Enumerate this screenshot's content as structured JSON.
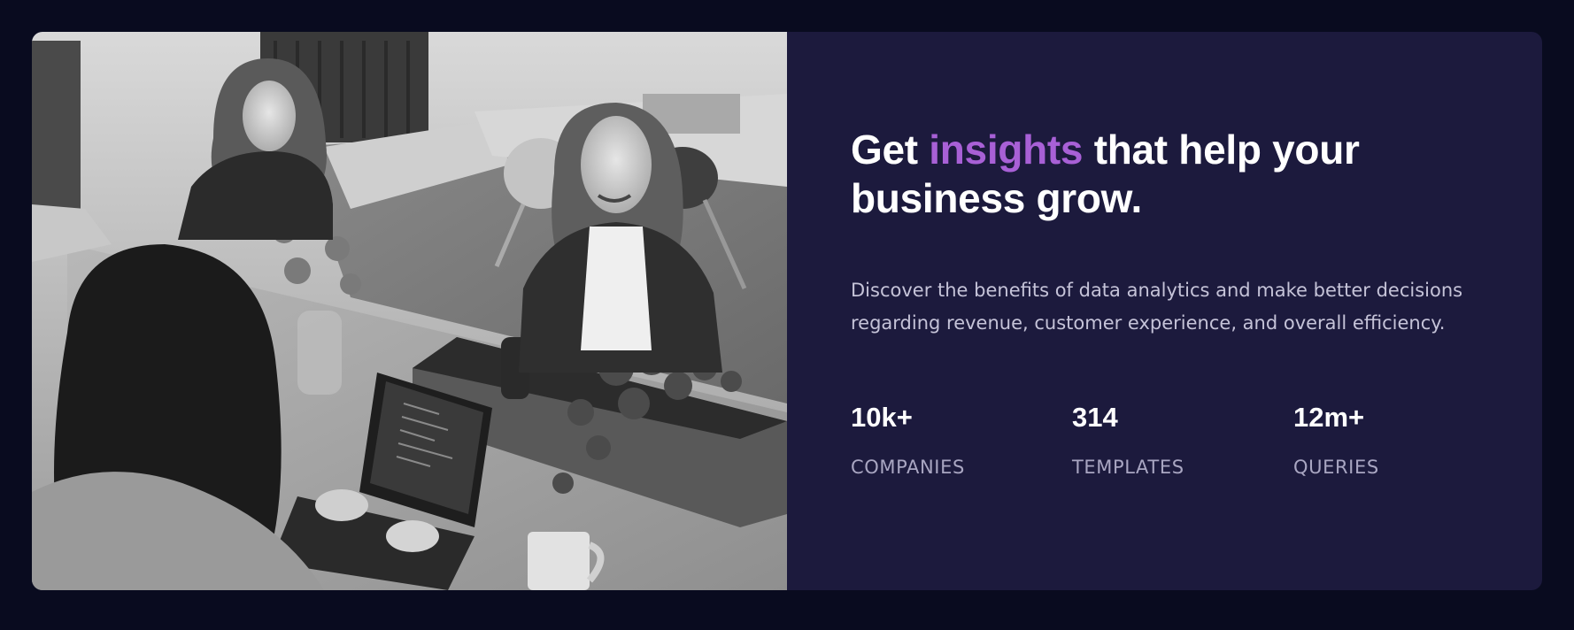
{
  "heading": {
    "prefix": "Get ",
    "highlight": "insights",
    "suffix": " that help your business grow."
  },
  "description": "Discover the benefits of data analytics and make better decisions regarding revenue, customer experience, and overall efficiency.",
  "stats": [
    {
      "value": "10k+",
      "label": "COMPANIES"
    },
    {
      "value": "314",
      "label": "TEMPLATES"
    },
    {
      "value": "12m+",
      "label": "QUERIES"
    }
  ],
  "colors": {
    "page_background": "#090b1f",
    "card_background": "#1c1a3d",
    "accent": "#a860d6",
    "heading": "#ffffff",
    "body_text": "#c5c3d8",
    "stat_label": "#a9a6c2"
  },
  "image": {
    "type": "photo",
    "style": "black-and-white",
    "content": "office-meeting"
  }
}
